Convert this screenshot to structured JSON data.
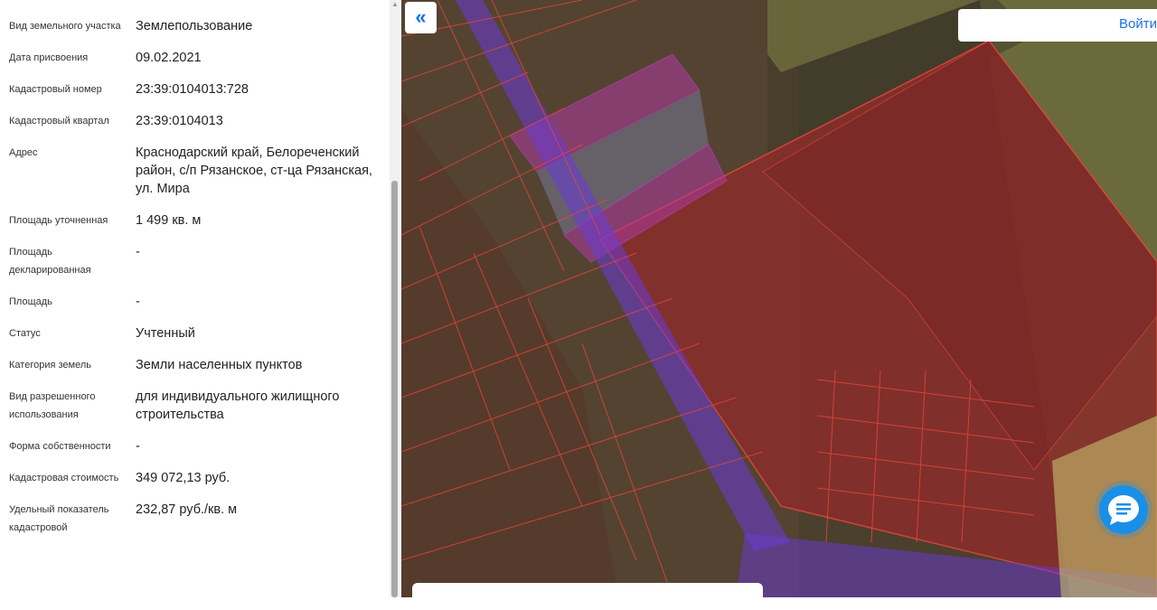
{
  "details": [
    {
      "label": "Вид земельного участка",
      "value": "Землепользование"
    },
    {
      "label": "Дата присвоения",
      "value": "09.02.2021"
    },
    {
      "label": "Кадастровый номер",
      "value": "23:39:0104013:728"
    },
    {
      "label": "Кадастровый квартал",
      "value": "23:39:0104013"
    },
    {
      "label": "Адрес",
      "value": "Краснодарский край, Белореченский район, с/п Рязанское, ст-ца Рязанская, ул. Мира"
    },
    {
      "label": "Площадь уточненная",
      "value": "1 499 кв. м"
    },
    {
      "label": "Площадь декларированная",
      "value": "-"
    },
    {
      "label": "Площадь",
      "value": "-"
    },
    {
      "label": "Статус",
      "value": "Учтенный"
    },
    {
      "label": "Категория земель",
      "value": "Земли населенных пунктов"
    },
    {
      "label": "Вид разрешенного использования",
      "value": "для индивидуального жилищного строительства"
    },
    {
      "label": "Форма собственности",
      "value": "-"
    },
    {
      "label": "Кадастровая стоимость",
      "value": "349 072,13 руб."
    },
    {
      "label": "Удельный показатель кадастровой",
      "value": "232,87 руб./кв. м"
    }
  ],
  "map": {
    "collapse_icon": "«",
    "login_label": "Войти",
    "chat_icon": "chat-icon"
  },
  "colors": {
    "accent": "#1a73e8",
    "parcel_red": "#e8463a",
    "zone_purple": "#c040e0"
  }
}
